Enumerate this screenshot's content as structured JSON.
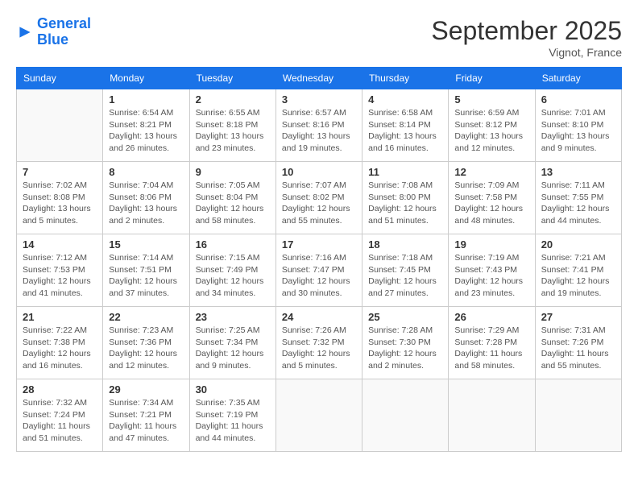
{
  "logo": {
    "line1": "General",
    "line2": "Blue"
  },
  "title": "September 2025",
  "location": "Vignot, France",
  "weekdays": [
    "Sunday",
    "Monday",
    "Tuesday",
    "Wednesday",
    "Thursday",
    "Friday",
    "Saturday"
  ],
  "weeks": [
    [
      {
        "day": "",
        "info": ""
      },
      {
        "day": "1",
        "info": "Sunrise: 6:54 AM\nSunset: 8:21 PM\nDaylight: 13 hours\nand 26 minutes."
      },
      {
        "day": "2",
        "info": "Sunrise: 6:55 AM\nSunset: 8:18 PM\nDaylight: 13 hours\nand 23 minutes."
      },
      {
        "day": "3",
        "info": "Sunrise: 6:57 AM\nSunset: 8:16 PM\nDaylight: 13 hours\nand 19 minutes."
      },
      {
        "day": "4",
        "info": "Sunrise: 6:58 AM\nSunset: 8:14 PM\nDaylight: 13 hours\nand 16 minutes."
      },
      {
        "day": "5",
        "info": "Sunrise: 6:59 AM\nSunset: 8:12 PM\nDaylight: 13 hours\nand 12 minutes."
      },
      {
        "day": "6",
        "info": "Sunrise: 7:01 AM\nSunset: 8:10 PM\nDaylight: 13 hours\nand 9 minutes."
      }
    ],
    [
      {
        "day": "7",
        "info": "Sunrise: 7:02 AM\nSunset: 8:08 PM\nDaylight: 13 hours\nand 5 minutes."
      },
      {
        "day": "8",
        "info": "Sunrise: 7:04 AM\nSunset: 8:06 PM\nDaylight: 13 hours\nand 2 minutes."
      },
      {
        "day": "9",
        "info": "Sunrise: 7:05 AM\nSunset: 8:04 PM\nDaylight: 12 hours\nand 58 minutes."
      },
      {
        "day": "10",
        "info": "Sunrise: 7:07 AM\nSunset: 8:02 PM\nDaylight: 12 hours\nand 55 minutes."
      },
      {
        "day": "11",
        "info": "Sunrise: 7:08 AM\nSunset: 8:00 PM\nDaylight: 12 hours\nand 51 minutes."
      },
      {
        "day": "12",
        "info": "Sunrise: 7:09 AM\nSunset: 7:58 PM\nDaylight: 12 hours\nand 48 minutes."
      },
      {
        "day": "13",
        "info": "Sunrise: 7:11 AM\nSunset: 7:55 PM\nDaylight: 12 hours\nand 44 minutes."
      }
    ],
    [
      {
        "day": "14",
        "info": "Sunrise: 7:12 AM\nSunset: 7:53 PM\nDaylight: 12 hours\nand 41 minutes."
      },
      {
        "day": "15",
        "info": "Sunrise: 7:14 AM\nSunset: 7:51 PM\nDaylight: 12 hours\nand 37 minutes."
      },
      {
        "day": "16",
        "info": "Sunrise: 7:15 AM\nSunset: 7:49 PM\nDaylight: 12 hours\nand 34 minutes."
      },
      {
        "day": "17",
        "info": "Sunrise: 7:16 AM\nSunset: 7:47 PM\nDaylight: 12 hours\nand 30 minutes."
      },
      {
        "day": "18",
        "info": "Sunrise: 7:18 AM\nSunset: 7:45 PM\nDaylight: 12 hours\nand 27 minutes."
      },
      {
        "day": "19",
        "info": "Sunrise: 7:19 AM\nSunset: 7:43 PM\nDaylight: 12 hours\nand 23 minutes."
      },
      {
        "day": "20",
        "info": "Sunrise: 7:21 AM\nSunset: 7:41 PM\nDaylight: 12 hours\nand 19 minutes."
      }
    ],
    [
      {
        "day": "21",
        "info": "Sunrise: 7:22 AM\nSunset: 7:38 PM\nDaylight: 12 hours\nand 16 minutes."
      },
      {
        "day": "22",
        "info": "Sunrise: 7:23 AM\nSunset: 7:36 PM\nDaylight: 12 hours\nand 12 minutes."
      },
      {
        "day": "23",
        "info": "Sunrise: 7:25 AM\nSunset: 7:34 PM\nDaylight: 12 hours\nand 9 minutes."
      },
      {
        "day": "24",
        "info": "Sunrise: 7:26 AM\nSunset: 7:32 PM\nDaylight: 12 hours\nand 5 minutes."
      },
      {
        "day": "25",
        "info": "Sunrise: 7:28 AM\nSunset: 7:30 PM\nDaylight: 12 hours\nand 2 minutes."
      },
      {
        "day": "26",
        "info": "Sunrise: 7:29 AM\nSunset: 7:28 PM\nDaylight: 11 hours\nand 58 minutes."
      },
      {
        "day": "27",
        "info": "Sunrise: 7:31 AM\nSunset: 7:26 PM\nDaylight: 11 hours\nand 55 minutes."
      }
    ],
    [
      {
        "day": "28",
        "info": "Sunrise: 7:32 AM\nSunset: 7:24 PM\nDaylight: 11 hours\nand 51 minutes."
      },
      {
        "day": "29",
        "info": "Sunrise: 7:34 AM\nSunset: 7:21 PM\nDaylight: 11 hours\nand 47 minutes."
      },
      {
        "day": "30",
        "info": "Sunrise: 7:35 AM\nSunset: 7:19 PM\nDaylight: 11 hours\nand 44 minutes."
      },
      {
        "day": "",
        "info": ""
      },
      {
        "day": "",
        "info": ""
      },
      {
        "day": "",
        "info": ""
      },
      {
        "day": "",
        "info": ""
      }
    ]
  ]
}
